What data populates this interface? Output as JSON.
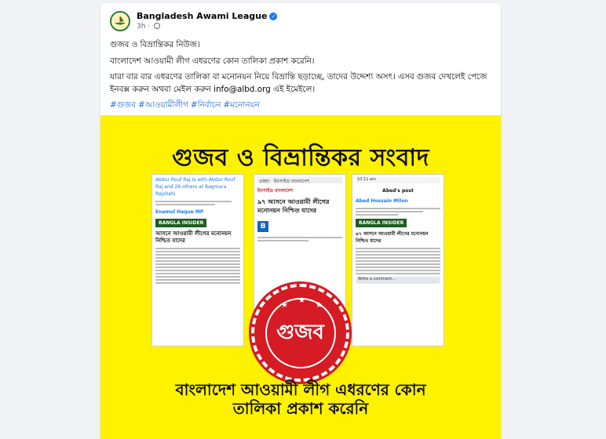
{
  "post": {
    "page_name": "Bangladesh Awami League",
    "time": "3h",
    "line1": "গুজব ও বিভ্রান্তিকর নিউজ।",
    "line2": "বাংলাদেশ আওয়ামী লীগ এধরণের কোন তালিকা প্রকাশ করেনি।",
    "line3": "যারা বার বার এধরণের তালিকা বা মনোনয়ন নিয়ে বিভ্রান্তি ছড়াচ্ছে, তাদের উদ্দেশ্য অসৎ। এসব গুজব দেখলেই পেজে ইনবক্স করুন অথবা মেইল করুন info@albd.org এই ইমেইলে।",
    "hashtags": [
      "#গুজব",
      "#আওয়ামীলীগ",
      "#নির্বাচন",
      "#মনোনয়ন"
    ]
  },
  "poster": {
    "title": "গুজব ও বিভ্রান্তিকর সংবাদ",
    "stamp_text": "গুজব",
    "footer_line1": "বাংলাদেশ আওয়ামী লীগ এধরণের কোন",
    "footer_line2": "তালিকা প্রকাশ করেনি",
    "shot1": {
      "author": "Abdur Rouf Raj is with Abdur Rouf Raj and 28 others at Bagmara Rajshahi",
      "mention": "Enamul Haque MP",
      "logo": "BANGLA INSIDER",
      "headline": "আসনে আওয়ামী লীগের মনোনয়ন নিশ্চিত যাদের"
    },
    "shot2": {
      "tab1": "প্রচ্ছদ",
      "tab2": "ইনসাইড বাংলাদেশ",
      "kicker": "ইনসাইড বাংলাদেশ",
      "headline": "৯৭ আসনে আওয়ামী লীগের মনোনয়ন নিশ্চিত যাদের"
    },
    "shot3": {
      "time": "10:11 am",
      "title": "Abed's post",
      "author": "Abed Hossain Milon",
      "logo": "BANGLA INSIDER",
      "headline": "৯৭ আসনে আওয়ামী লীগের মনোনয়ন নিশ্চিত যাদের",
      "comment_placeholder": "Write a comment..."
    }
  },
  "colors": {
    "poster_bg": "#fff200",
    "stamp": "#d51b23",
    "hashtag": "#216fdb",
    "verified": "#1877f2"
  }
}
